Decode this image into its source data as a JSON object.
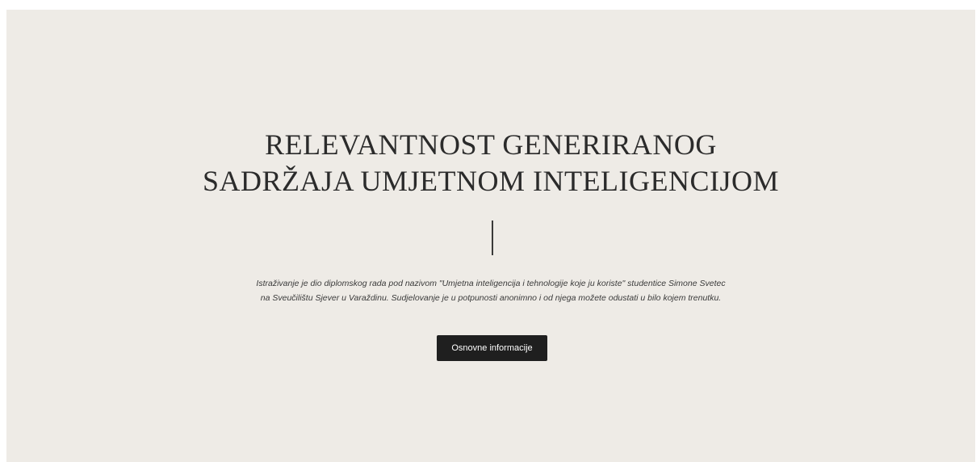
{
  "hero": {
    "title_line1": "RELEVANTNOST GENERIRANOG",
    "title_line2": "SADRŽAJA UMJETNOM INTELIGENCIJOM",
    "description_line1": "Istraživanje je dio diplomskog rada pod nazivom \"Umjetna inteligencija i tehnologije koje ju koriste\" studentice Simone Svetec",
    "description_line2": "na Sveučilištu Sjever u Varaždinu. Sudjelovanje je u potpunosti anonimno i od njega možete odustati u bilo kojem trenutku.",
    "button_label": "Osnovne informacije"
  },
  "colors": {
    "background": "#eeebe6",
    "button": "#1f1f1f",
    "text": "#2b2b2b"
  }
}
